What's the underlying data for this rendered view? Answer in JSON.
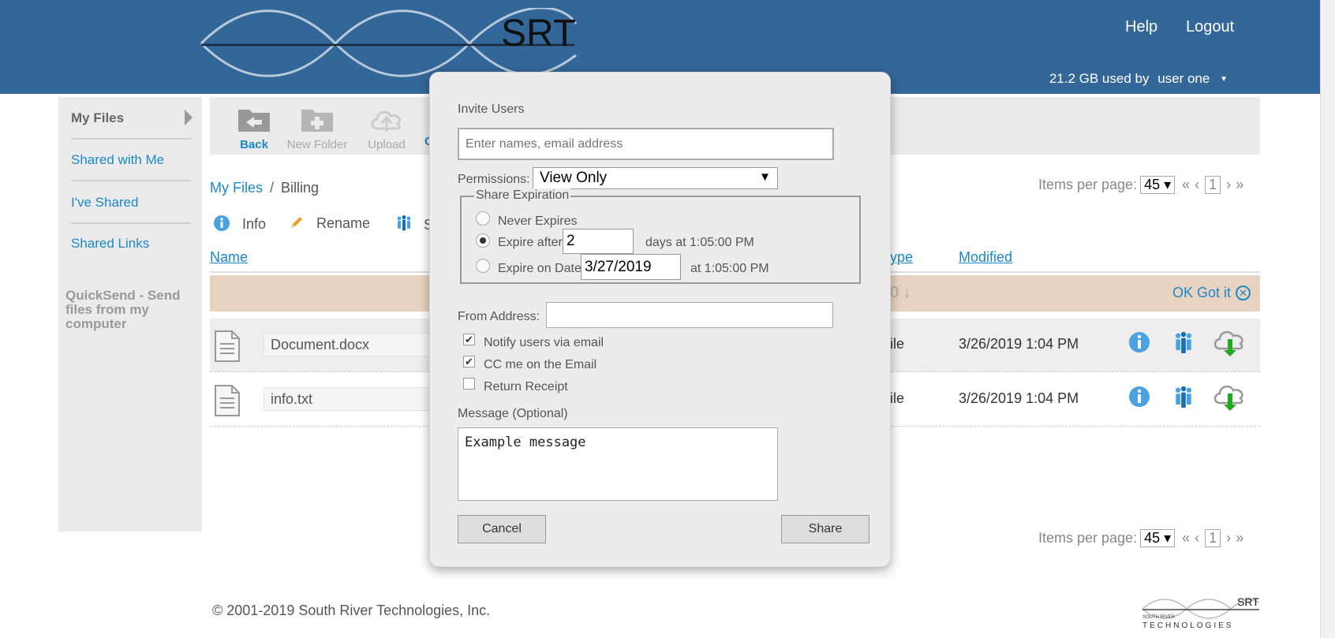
{
  "header": {
    "logo_text": "SRT",
    "help": "Help",
    "logout": "Logout",
    "usage": "21.2 GB used by",
    "user": "user one",
    "brand_color": "#336699"
  },
  "sidebar": {
    "items": [
      {
        "label": "My Files"
      },
      {
        "label": "Shared with Me"
      },
      {
        "label": "I've Shared"
      },
      {
        "label": "Shared Links"
      }
    ],
    "quicksend": "QuickSend - Send files from my computer"
  },
  "toolbar": {
    "back": "Back",
    "new_folder": "New Folder",
    "upload": "Upload",
    "partial": "C"
  },
  "breadcrumb": {
    "root": "My Files",
    "sep": "/",
    "current": "Billing"
  },
  "pager": {
    "label": "Items per page:",
    "per_page": "45",
    "first": "«",
    "prev": "‹",
    "page": "1",
    "next": "›",
    "last": "»"
  },
  "actions": {
    "info": "Info",
    "rename": "Rename",
    "share_partial": "S"
  },
  "columns": {
    "name": "Name",
    "type": "ype",
    "modified": "Modified"
  },
  "notice": {
    "partial": "0 ↓",
    "ok": "OK Got it"
  },
  "files": [
    {
      "name": "Document.docx",
      "type": "ile",
      "modified": "3/26/2019 1:04 PM"
    },
    {
      "name": "info.txt",
      "type": "ile",
      "modified": "3/26/2019 1:04 PM"
    }
  ],
  "footer": {
    "copyright": "© 2001-2019 South River Technologies, Inc.",
    "logo_line1": "SOUTH RIVER",
    "logo_line2": "TECHNOLOGIES",
    "logo_srt": "SRT"
  },
  "modal": {
    "invite_label": "Invite Users",
    "invite_placeholder": "Enter names, email address",
    "permissions_label": "Permissions:",
    "permissions_value": "View Only",
    "expiration_legend": "Share Expiration",
    "never": "Never Expires",
    "expire_after": "Expire after:",
    "expire_after_value": "2",
    "days_at": "days at 1:05:00 PM",
    "expire_on": "Expire on Date:",
    "expire_on_value": "3/27/2019",
    "at_time": "at 1:05:00 PM",
    "from_label": "From Address:",
    "from_value": "",
    "notify": "Notify users via email",
    "cc": "CC me on the Email",
    "receipt": "Return Receipt",
    "message_label": "Message (Optional)",
    "message_value": "Example message",
    "cancel": "Cancel",
    "share": "Share"
  }
}
